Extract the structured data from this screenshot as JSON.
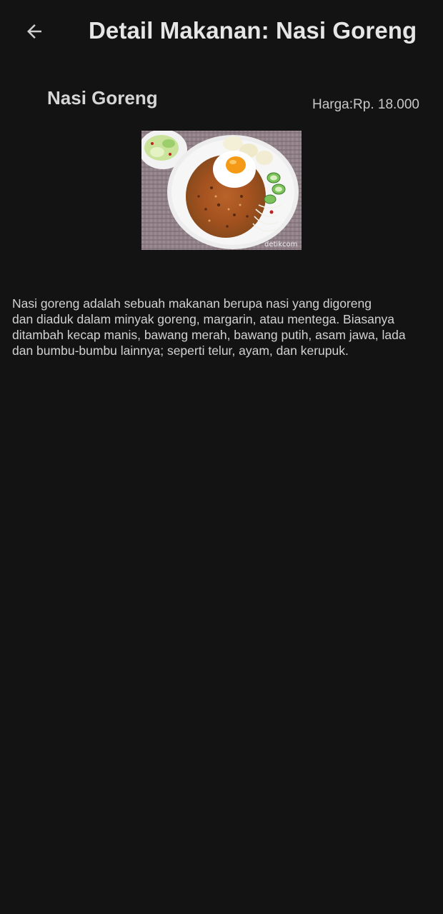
{
  "header": {
    "title": "Detail Makanan: Nasi Goreng",
    "back_icon": "arrow-left-icon"
  },
  "food": {
    "name": "Nasi Goreng",
    "price": "Harga:Rp. 18.000",
    "image": {
      "description": "plate of nasi goreng topped with fried egg, cucumber, cabbage and crackers",
      "watermark": "detikcom"
    },
    "description_lines": [
      "Nasi goreng adalah sebuah makanan berupa nasi yang digoreng",
      "dan diaduk dalam minyak goreng, margarin, atau mentega. Biasanya",
      "ditambah kecap manis, bawang merah, bawang putih, asam jawa, lada",
      "dan bumbu-bumbu lainnya; seperti telur, ayam, dan kerupuk."
    ]
  },
  "colors": {
    "background": "#131313",
    "title_text": "#e6e6e6",
    "body_text": "#d2d2d2"
  }
}
